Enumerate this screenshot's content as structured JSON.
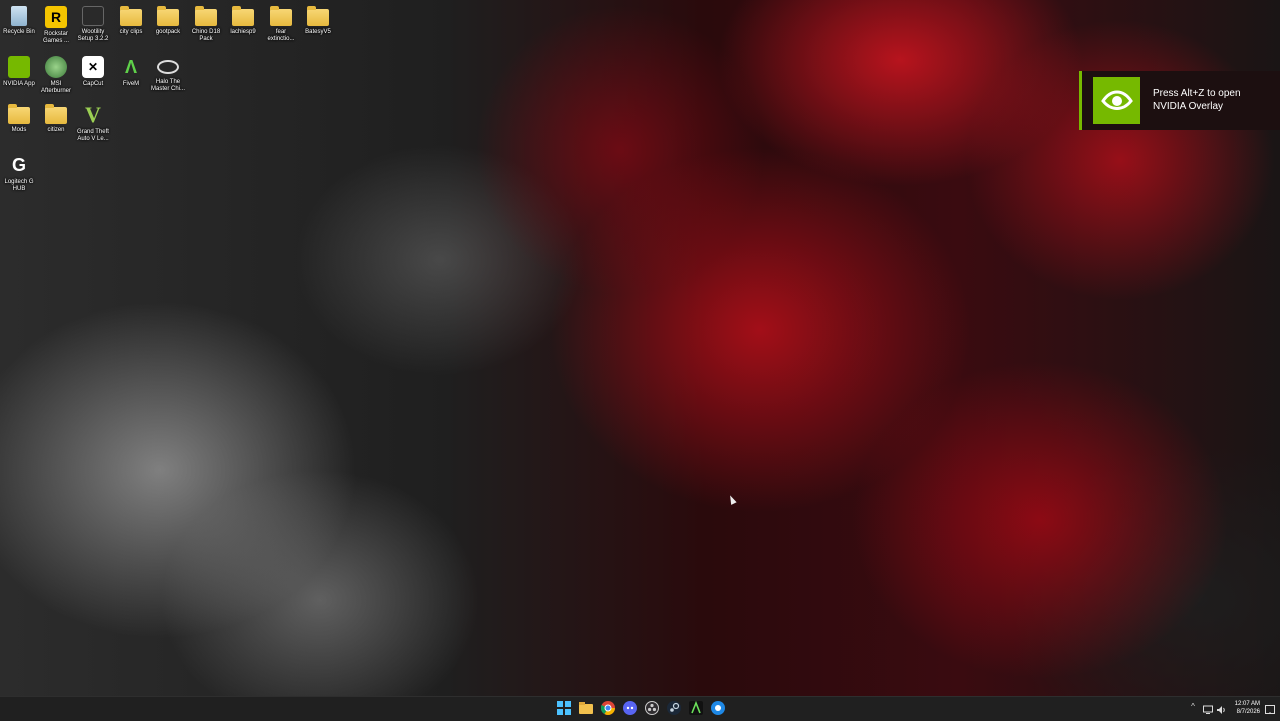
{
  "desktop": {
    "icons": [
      {
        "label": "Recycle Bin",
        "icon": "recycle-bin-icon"
      },
      {
        "label": "Rockstar Games ...",
        "icon": "rockstar-icon"
      },
      {
        "label": "Wootility Setup 3.2.2",
        "icon": "wootility-icon"
      },
      {
        "label": "city clips",
        "icon": "folder-icon"
      },
      {
        "label": "gootpack",
        "icon": "folder-icon"
      },
      {
        "label": "Chino D18 Pack",
        "icon": "folder-icon"
      },
      {
        "label": "lachiesp9",
        "icon": "folder-icon"
      },
      {
        "label": "fear extinctio...",
        "icon": "folder-icon"
      },
      {
        "label": "BatesyV5",
        "icon": "folder-icon"
      },
      {
        "label": "NVIDIA App",
        "icon": "nvidia-icon"
      },
      {
        "label": "MSI Afterburner",
        "icon": "msi-afterburner-icon"
      },
      {
        "label": "CapCut",
        "icon": "capcut-icon"
      },
      {
        "label": "FiveM",
        "icon": "fivem-icon"
      },
      {
        "label": "Halo The Master Chi...",
        "icon": "halo-icon"
      },
      {
        "label": "Mods",
        "icon": "folder-icon"
      },
      {
        "label": "citizen",
        "icon": "folder-icon"
      },
      {
        "label": "Grand Theft Auto V Le...",
        "icon": "gta-v-icon"
      },
      {
        "label": "Logitech G HUB",
        "icon": "logitech-icon"
      }
    ]
  },
  "notification": {
    "line1": "Press Alt+Z to open",
    "line2": "NVIDIA Overlay",
    "accent": "#76b900"
  },
  "taskbar": {
    "apps": [
      "windows-start-icon",
      "file-explorer-icon",
      "chrome-icon",
      "discord-icon",
      "obs-icon",
      "steam-icon",
      "fivem-icon",
      "app-icon"
    ],
    "clock": {
      "time": "12:07 AM",
      "date": "8/7/2026"
    }
  }
}
